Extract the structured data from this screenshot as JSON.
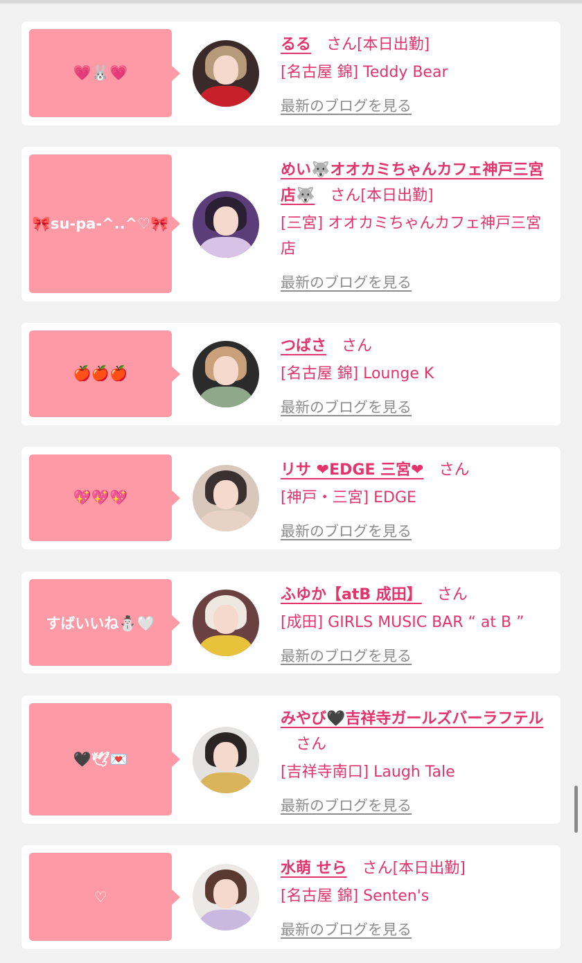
{
  "cards": [
    {
      "bubble": "💗🐰💗",
      "name": "るる",
      "suffix": "さん[本日出勤]",
      "shop": "[名古屋 錦] Teddy Bear",
      "blog": "最新のブログを見る",
      "avatar_colors": {
        "bg": "#3a2a2a",
        "hair": "#b69a7a",
        "body": "#c8202a"
      }
    },
    {
      "bubble": "🎀su-pa-^..^♡🎀",
      "name": "めい🐺オオカミちゃんカフェ神戸三宮店🐺",
      "suffix": "さん[本日出勤]",
      "shop": "[三宮] オオカミちゃんカフェ神戸三宮店",
      "blog": "最新のブログを見る",
      "avatar_colors": {
        "bg": "#5b3d7a",
        "hair": "#2a1f33",
        "body": "#d8c3e6"
      }
    },
    {
      "bubble": "🍎🍎🍎",
      "name": "つばさ",
      "suffix": "さん",
      "shop": "[名古屋 錦] Lounge K",
      "blog": "最新のブログを見る",
      "avatar_colors": {
        "bg": "#2b2b2b",
        "hair": "#c9a07a",
        "body": "#8fa88a"
      }
    },
    {
      "bubble": "💖💖💖",
      "name": "リサ ❤EDGE 三宮❤",
      "suffix": "さん",
      "shop": "[神戸・三宮] EDGE",
      "blog": "最新のブログを見る",
      "avatar_colors": {
        "bg": "#d8c8bc",
        "hair": "#3a3030",
        "body": "#e8d2c6"
      }
    },
    {
      "bubble": "すばいいね⛄🤍",
      "name": "ふゆか【atB 成田】",
      "suffix": "さん",
      "shop": "[成田] GIRLS MUSIC BAR “ at B ”",
      "blog": "最新のブログを見る",
      "avatar_colors": {
        "bg": "#6b4040",
        "hair": "#efe8e0",
        "body": "#e8c23a"
      }
    },
    {
      "bubble": "🖤🕊💌",
      "name": "みやび🖤吉祥寺ガールズバーラフテル",
      "suffix": "さん",
      "shop": "[吉祥寺南口] Laugh Tale",
      "blog": "最新のブログを見る",
      "avatar_colors": {
        "bg": "#e4e2e0",
        "hair": "#2a2424",
        "body": "#d9b45a"
      }
    },
    {
      "bubble": "♡",
      "name": "水萌 せら",
      "suffix": "さん[本日出勤]",
      "shop": "[名古屋 錦] Senten's",
      "blog": "最新のブログを見る",
      "avatar_colors": {
        "bg": "#ece8e6",
        "hair": "#5a3a30",
        "body": "#c9b8e0"
      }
    }
  ]
}
